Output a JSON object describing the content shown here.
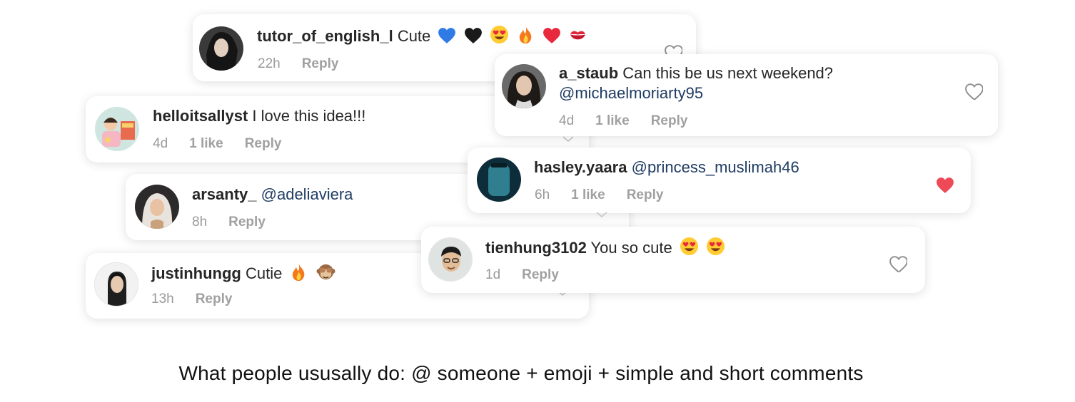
{
  "comments": [
    {
      "user": "tutor_of_english_l",
      "text": "Cute",
      "time": "22h",
      "reply": "Reply",
      "emojis": [
        "blue-heart",
        "black-heart",
        "heart-eyes",
        "fire",
        "red-heart",
        "kiss-mark"
      ]
    },
    {
      "user": "a_staub",
      "text": "Can this be us next weekend?",
      "mention": "@michaelmoriarty95",
      "time": "4d",
      "likes": "1 like",
      "reply": "Reply",
      "liked": false
    },
    {
      "user": "helloitsallyst",
      "text": "I love this idea!!!",
      "time": "4d",
      "likes": "1 like",
      "reply": "Reply"
    },
    {
      "user": "hasley.yaara",
      "mention": "@princess_muslimah46",
      "time": "6h",
      "likes": "1 like",
      "reply": "Reply",
      "liked": true
    },
    {
      "user": "arsanty_",
      "mention": "@adeliaviera",
      "time": "8h",
      "reply": "Reply"
    },
    {
      "user": "tienhung3102",
      "text": "You so cute",
      "time": "1d",
      "reply": "Reply",
      "liked": false,
      "emojis": [
        "heart-eyes",
        "heart-eyes"
      ]
    },
    {
      "user": "justinhungg",
      "text": "Cutie",
      "time": "13h",
      "reply": "Reply",
      "emojis": [
        "fire",
        "see-no-evil-monkey"
      ]
    }
  ],
  "caption": "What people ususally do: @ someone + emoji + simple and short comments",
  "colors": {
    "like_red": "#ed4956",
    "mention_blue": "#1f3c63",
    "meta_gray": "#9a9a9a"
  }
}
